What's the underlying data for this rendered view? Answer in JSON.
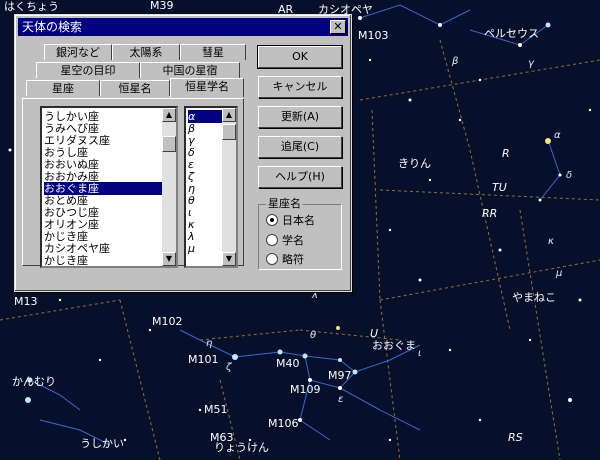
{
  "dialog": {
    "title": "天体の検索",
    "close_glyph": "✕",
    "tabs_row1": [
      "銀河など",
      "太陽系",
      "彗星"
    ],
    "tabs_row2": [
      "星空の目印",
      "中国の星宿"
    ],
    "tabs_row3": [
      "星座",
      "恒星名",
      "恒星学名"
    ],
    "active_tab": "恒星学名",
    "constellations": [
      "うしかい座",
      "うみへび座",
      "エリダヌス座",
      "おうし座",
      "おおいぬ座",
      "おおかみ座",
      "おおぐま座",
      "おとめ座",
      "おひつじ座",
      "オリオン座",
      "かじき座",
      "カシオペヤ座",
      "かじき座"
    ],
    "selected_constellation": "おおぐま座",
    "greek_letters": [
      "α",
      "β",
      "γ",
      "δ",
      "ε",
      "ζ",
      "η",
      "θ",
      "ι",
      "κ",
      "λ",
      "μ"
    ],
    "selected_greek": "α",
    "buttons": {
      "ok": "OK",
      "cancel": "キャンセル",
      "update": "更新(A)",
      "track": "追尾(C)",
      "help": "ヘルプ(H)"
    },
    "group_label": "星座名",
    "radio_options": [
      "日本名",
      "学名",
      "略符"
    ],
    "radio_selected": "日本名"
  },
  "sky_labels": {
    "hakucho": "はくちょう",
    "m39": "M39",
    "ar": "ΑR",
    "cassiopeia": "カシオペヤ",
    "m103": "M103",
    "perseus": "ペルセウス",
    "kirin": "きりん",
    "yamaneko": "やまねこ",
    "oogma": "おおぐま",
    "m13": "M13",
    "m102": "M102",
    "m101": "M101",
    "m40": "M40",
    "m97": "M97",
    "m109": "M109",
    "m51": "M51",
    "m106": "M106",
    "m63": "M63",
    "ushikai": "うしかい",
    "ryoken": "りょうけん",
    "kanmuri": "かんむり",
    "var_r": "R",
    "var_tu": "TU",
    "var_rr": "RR",
    "var_u": "U",
    "var_rs": "RS"
  },
  "colors": {
    "sky": "#06102a",
    "star_bright": "#bfe8ff",
    "star_yellow": "#f4e38a",
    "line_blue": "#3a66d8",
    "boundary": "#9a6f33",
    "title_bar": "#000080",
    "dialog_face": "#c0c0c0"
  }
}
